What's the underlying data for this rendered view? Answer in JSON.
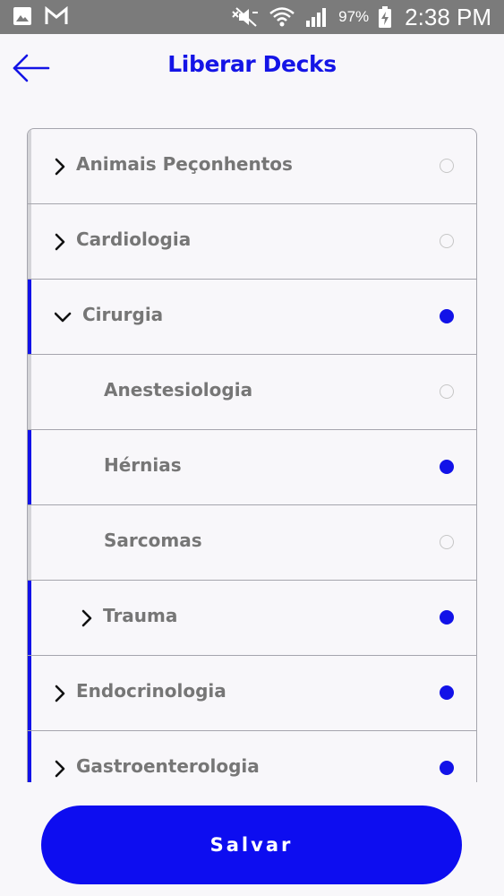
{
  "status_bar": {
    "icons_left": [
      "image-icon",
      "gmail-icon"
    ],
    "icons_right": [
      "mute-icon",
      "wifi-icon",
      "signal-icon",
      "battery-charging-icon"
    ],
    "battery": "97%",
    "time": "2:38 PM"
  },
  "header": {
    "title": "Liberar Decks",
    "back_icon": "arrow-left-icon"
  },
  "colors": {
    "accent": "#1212e8",
    "title": "#1414e6",
    "text": "#767676",
    "divider": "#a5a5ad",
    "inactive_bar": "#d4d4d8"
  },
  "decks": [
    {
      "label": "Animais Peçonhentos",
      "level": 0,
      "expander": "collapsed",
      "selected": false
    },
    {
      "label": "Cardiologia",
      "level": 0,
      "expander": "collapsed",
      "selected": false
    },
    {
      "label": "Cirurgia",
      "level": 0,
      "expander": "expanded",
      "selected": true
    },
    {
      "label": "Anestesiologia",
      "level": 1,
      "expander": "none",
      "selected": false
    },
    {
      "label": "Hérnias",
      "level": 1,
      "expander": "none",
      "selected": true
    },
    {
      "label": "Sarcomas",
      "level": 1,
      "expander": "none",
      "selected": false
    },
    {
      "label": "Trauma",
      "level": 1,
      "expander": "collapsed",
      "selected": true
    },
    {
      "label": "Endocrinologia",
      "level": 0,
      "expander": "collapsed",
      "selected": true
    },
    {
      "label": "Gastroenterologia",
      "level": 0,
      "expander": "collapsed",
      "selected": true
    }
  ],
  "save_label": "Salvar"
}
